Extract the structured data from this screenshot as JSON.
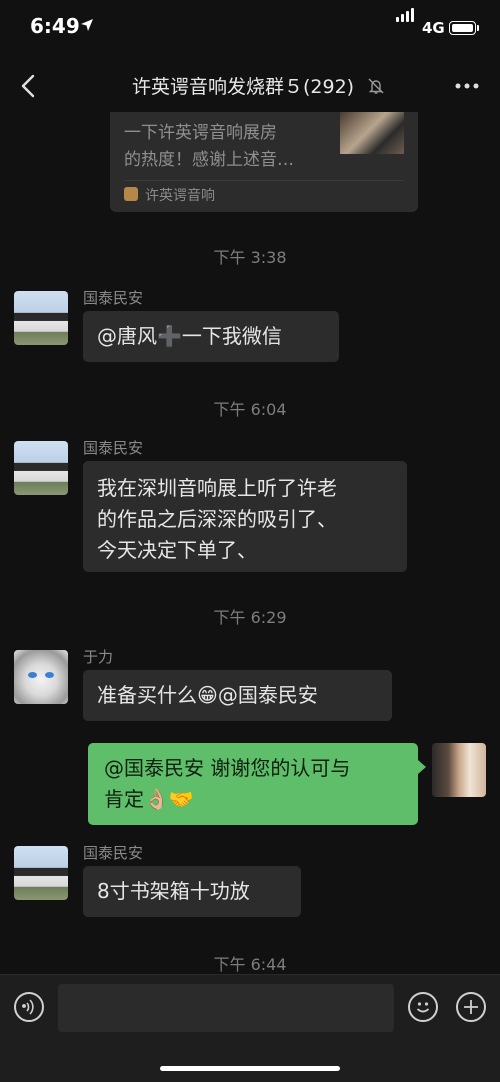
{
  "status": {
    "time": "6:49",
    "network": "4G"
  },
  "nav": {
    "title": "许英谔音响发烧群５(292)"
  },
  "card": {
    "line1": "一下许英谔音响展房",
    "line2": "的热度！感谢上述音…",
    "source": "许英谔音响"
  },
  "messages": [
    {
      "time": "下午 3:38",
      "sender": "国泰民安",
      "text": "@唐风➕一下我微信"
    },
    {
      "time": "下午 6:04",
      "sender": "国泰民安",
      "lines": [
        "我在深圳音响展上听了许老",
        "的作品之后深深的吸引了、",
        "今天决定下单了、"
      ]
    },
    {
      "time": "下午 6:29",
      "sender": "于力",
      "text": "准备买什么😁@国泰民安"
    },
    {
      "self": true,
      "lines": [
        "@国泰民安 谢谢您的认可与",
        "肯定👌🏼🤝"
      ]
    },
    {
      "sender": "国泰民安",
      "text": "8寸书架箱十功放"
    },
    {
      "time": "下午 6:44"
    }
  ],
  "icons": {
    "back": "chevron-left-icon",
    "mute": "bell-slash-icon",
    "more": "ellipsis-icon",
    "voice": "voice-icon",
    "emoji": "emoji-icon",
    "plus": "plus-icon"
  },
  "colors": {
    "background": "#111111",
    "bubble_other": "#2c2c2c",
    "bubble_self": "#5fbe6a"
  }
}
